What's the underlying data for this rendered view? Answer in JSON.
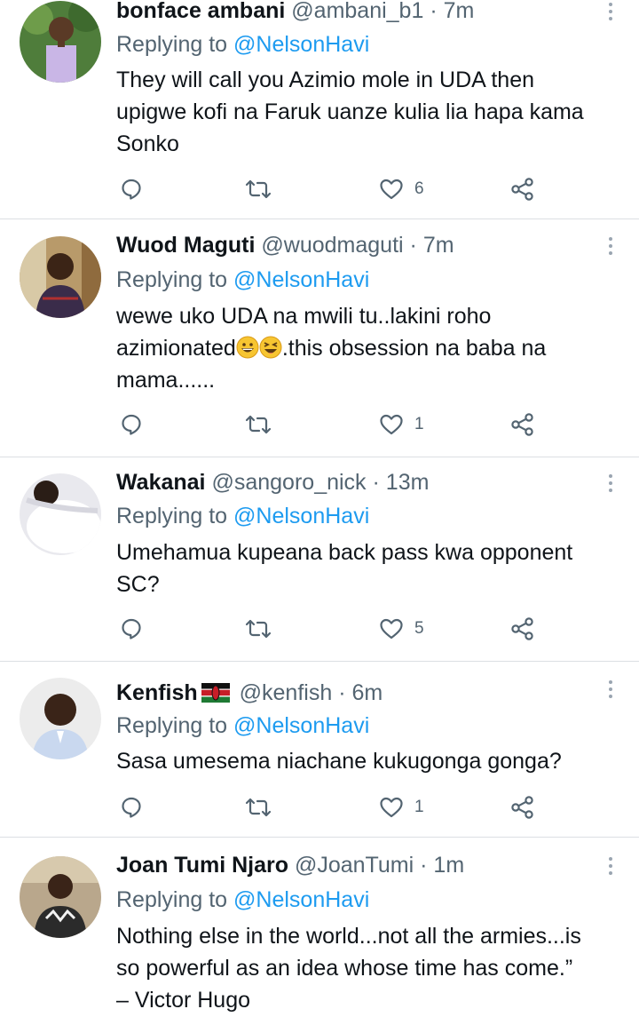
{
  "tweets": [
    {
      "name": "bonface ambani",
      "handle": "@ambani_b1",
      "separator": "·",
      "time": "7m",
      "replying_label": "Replying to",
      "replying_to": "@NelsonHavi",
      "lines": [
        "They will call you Azimio mole in UDA then",
        "upigwe kofi na Faruk uanze kulia lia hapa kama",
        "Sonko"
      ],
      "likes": "6"
    },
    {
      "name": "Wuod Maguti",
      "handle": "@wuodmaguti",
      "separator": "·",
      "time": "7m",
      "replying_label": "Replying to",
      "replying_to": "@NelsonHavi",
      "lines": [
        "wewe uko UDA na mwili tu..lakini roho",
        "azimionated",
        ".this obsession na baba na",
        "mama......"
      ],
      "likes": "1"
    },
    {
      "name": "Wakanai",
      "handle": "@sangoro_nick",
      "separator": "·",
      "time": "13m",
      "replying_label": "Replying to",
      "replying_to": "@NelsonHavi",
      "lines": [
        "Umehamua kupeana back pass kwa opponent",
        "SC?"
      ],
      "likes": "5"
    },
    {
      "name": "Kenfish",
      "handle": "@kenfish",
      "separator": "·",
      "time": "6m",
      "replying_label": "Replying to",
      "replying_to": "@NelsonHavi",
      "lines": [
        "Sasa umesema niachane kukugonga gonga?"
      ],
      "likes": "1"
    },
    {
      "name": "Joan Tumi Njaro",
      "handle": "@JoanTumi",
      "separator": "·",
      "time": "1m",
      "replying_label": "Replying to",
      "replying_to": "@NelsonHavi",
      "lines": [
        "Nothing else in the world...not all the armies...is",
        "so powerful as an idea whose time has come.”",
        "– Victor Hugo"
      ],
      "likes": ""
    }
  ],
  "icons": {
    "reply": "comment-icon",
    "retweet": "retweet-icon",
    "like": "heart-icon",
    "share": "share-icon",
    "more": "more-vertical-icon",
    "flag": "kenya-flag-icon"
  },
  "colors": {
    "link": "#1d9bf0",
    "muted": "#536471",
    "text": "#0f1419"
  }
}
